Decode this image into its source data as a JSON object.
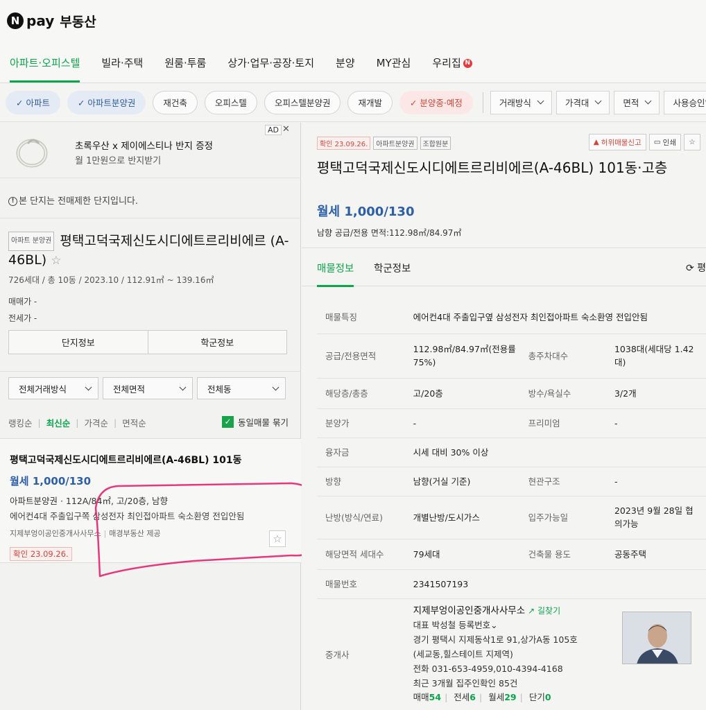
{
  "brand": {
    "logo_letter": "N",
    "pay": "pay",
    "name": "부동산"
  },
  "nav": [
    "아파트·오피스텔",
    "빌라·주택",
    "원룸·투룸",
    "상가·업무·공장·토지",
    "분양",
    "MY관심",
    "우리집"
  ],
  "nav_badge": "N",
  "filters": {
    "chips": [
      "✓ 아파트",
      "✓ 아파트분양권",
      "재건축",
      "오피스텔",
      "오피스텔분양권",
      "재개발",
      "✓ 분양중·예정"
    ],
    "dropdowns": [
      "거래방식",
      "가격대",
      "면적",
      "사용승인일"
    ]
  },
  "ad": {
    "tag": "AD",
    "close": "✕",
    "title": "초록우산 x 제이에스티나 반지 증정",
    "subtitle": "월 1만원으로 반지받기"
  },
  "notice": {
    "icon": "!",
    "text": "본 단지는 전매제한 단지입니다."
  },
  "complex": {
    "tag": "아파트 분양권",
    "name": "평택고덕국제신도시디에트르리비에르 (A-46BL)",
    "star": "☆",
    "meta": "726세대 / 총 10동 / 2023.10 / 112.91㎡ ~ 139.16㎡",
    "sale_price": "매매가 -",
    "jeonse_price": "전세가 -",
    "btn_info": "단지정보",
    "btn_school": "학군정보"
  },
  "list_filters": [
    "전체거래방식",
    "전체면적",
    "전체동"
  ],
  "sort": {
    "items": [
      "랭킹순",
      "최신순",
      "가격순",
      "면적순"
    ],
    "same_listing": "동일매물 묶기",
    "check": "✓"
  },
  "listing": {
    "title": "평택고덕국제신도시디에트르리비에르(A-46BL) 101동",
    "price": "월세 1,000/130",
    "spec": "아파트분양권 · 112A/84㎡, 고/20층, 남향",
    "desc": "에어컨4대 주출입구쪽 삼성전자 최인접아파트 숙소환영 전입안됨",
    "agent": "지제부엉이공인중개사사무소",
    "provider": "매경부동산 제공",
    "confirm": "확인 23.09.26.",
    "star": "☆"
  },
  "detail": {
    "tags": [
      "확인 23.09.26.",
      "아파트분양권",
      "조합원분"
    ],
    "report_btn": "허위매물신고",
    "print_btn": "인쇄",
    "title": "평택고덕국제신도시디에트르리비에르(A-46BL) 101동·고층",
    "price": "월세 1,000/130",
    "meta": "남향  공급/전용 면적:112.98㎡/84.97㎡",
    "tabs": [
      "매물정보",
      "학군정보"
    ],
    "refresh": "⟳ 평",
    "rows": {
      "feature": {
        "k": "매물특징",
        "v": "에어컨4대 주출입구옆 삼성전자 최인접아파트 숙소환영 전입안됨"
      },
      "area": {
        "k": "공급/전용면적",
        "v": "112.98㎡/84.97㎡(전용률75%)",
        "k2": "총주차대수",
        "v2": "1038대(세대당 1.42대)"
      },
      "floor": {
        "k": "해당층/총층",
        "v": "고/20층",
        "k2": "방수/욕실수",
        "v2": "3/2개"
      },
      "sale": {
        "k": "분양가",
        "v": "-",
        "k2": "프리미엄",
        "v2": "-"
      },
      "loan": {
        "k": "융자금",
        "v": "시세 대비 30% 이상"
      },
      "dir": {
        "k": "방향",
        "v": "남향(거실 기준)",
        "k2": "현관구조",
        "v2": "-"
      },
      "heat": {
        "k": "난방(방식/연료)",
        "v": "개별난방/도시가스",
        "k2": "입주가능일",
        "v2": "2023년 9월 28일 협의가능"
      },
      "units": {
        "k": "해당면적 세대수",
        "v": "79세대",
        "k2": "건축물 용도",
        "v2": "공동주택"
      },
      "no": {
        "k": "매물번호",
        "v": "2341507193"
      }
    },
    "agent": {
      "k": "중개사",
      "name": "지제부엉이공인중개사사무소",
      "route": "↗ 길찾기",
      "rep": "대표 박성철 등록번호⌄",
      "addr1": "경기 평택시 지제동삭1로 91,상가A동 105호",
      "addr2": "(세교동,힐스테이트 지제역)",
      "tel": "전화 031-653-4959,010-4394-4168",
      "recent": "최근 3개월 집주인확인 85건",
      "counts": {
        "sale_label": "매매",
        "sale": "54",
        "jeonse_label": "전세",
        "jeonse": "6",
        "monthly_label": "월세",
        "monthly": "29",
        "short_label": "단기",
        "short": "0"
      }
    }
  },
  "colors": {
    "accent": "#0aa64a",
    "price": "#2d5fa8",
    "confirm": "#d2463a",
    "annotation": "#e8367a"
  }
}
